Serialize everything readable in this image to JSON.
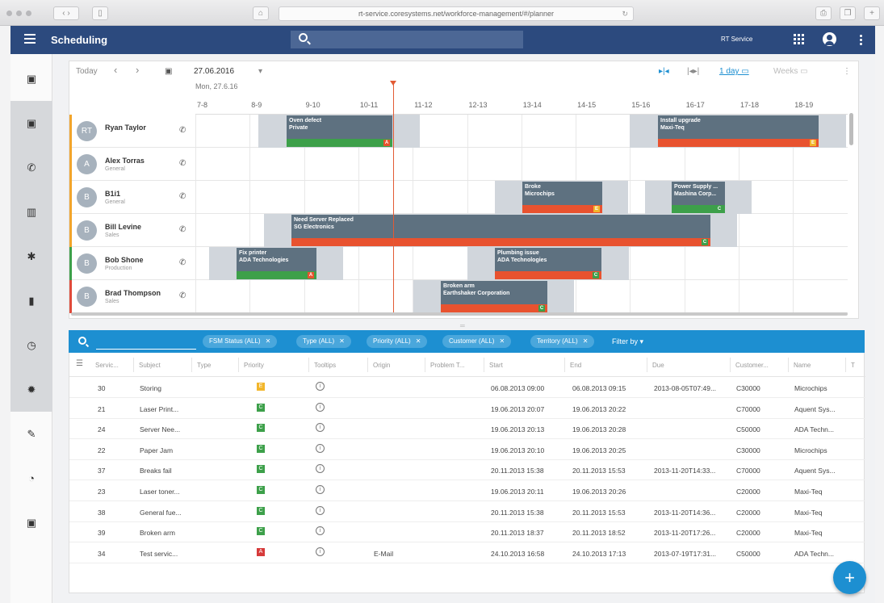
{
  "browser": {
    "url": "rt-service.coresystems.net/workforce-management/#/planner"
  },
  "app": {
    "title": "Scheduling",
    "account": "RT Service"
  },
  "toolbar": {
    "today": "Today",
    "prev": "‹",
    "next": "›",
    "date": "27.06.2016",
    "one_day": "1 day",
    "weeks": "Weeks"
  },
  "planner": {
    "subheader": "Mon, 27.6.16",
    "hours": [
      "7-8",
      "8-9",
      "9-10",
      "10-11",
      "11-12",
      "12-13",
      "13-14",
      "14-15",
      "15-16",
      "16-17",
      "17-18",
      "18-19"
    ],
    "rows": [
      {
        "initials": "RT",
        "name": "Ryan Taylor",
        "sub": "",
        "color": "#f2a52b"
      },
      {
        "initials": "A",
        "name": "Alex Torras",
        "sub": "General",
        "color": "#f2a52b"
      },
      {
        "initials": "B",
        "name": "B1i1",
        "sub": "General",
        "color": "#f2a52b"
      },
      {
        "initials": "B",
        "name": "Bill Levine",
        "sub": "Sales",
        "color": "#f2a52b"
      },
      {
        "initials": "B",
        "name": "Bob Shone",
        "sub": "Production",
        "color": "#3da04a"
      },
      {
        "initials": "B",
        "name": "Brad Thompson",
        "sub": "Sales",
        "color": "#e04a3a"
      }
    ],
    "events": [
      {
        "l1": "Oven defect",
        "l2": "Private",
        "prio": "A"
      },
      {
        "l1": "Install upgrade",
        "l2": "Maxi-Teq",
        "prio": "E"
      },
      {
        "l1": "Broke",
        "l2": "Microchips",
        "prio": "E"
      },
      {
        "l1": "Power Supply ...",
        "l2": "Mashina Corp...",
        "prio": "C"
      },
      {
        "l1": "Need Server Replaced",
        "l2": "SG Electronics",
        "prio": "C"
      },
      {
        "l1": "Fix printer",
        "l2": "ADA Technologies",
        "prio": "A"
      },
      {
        "l1": "Plumbing issue",
        "l2": "ADA Technologies",
        "prio": "C"
      },
      {
        "l1": "Broken arm",
        "l2": "Earthshaker Corporation",
        "prio": "C"
      }
    ]
  },
  "filters": {
    "chips": [
      "FSM Status (ALL)",
      "Type (ALL)",
      "Priority (ALL)",
      "Customer (ALL)",
      "Territory (ALL)"
    ],
    "close": "✕",
    "filter_by": "Filter by"
  },
  "table": {
    "headers": [
      "Servic...",
      "Subject",
      "Type",
      "Priority",
      "Tooltips",
      "Origin",
      "Problem T...",
      "Start",
      "End",
      "Due",
      "Customer...",
      "Name",
      "T"
    ],
    "rows": [
      {
        "id": "30",
        "subject": "Storing",
        "prio": "E",
        "origin": "",
        "start": "06.08.2013 09:00",
        "end": "06.08.2013 09:15",
        "due": "2013-08-05T07:49...",
        "customer": "C30000",
        "name": "Microchips"
      },
      {
        "id": "21",
        "subject": "Laser Print...",
        "prio": "C",
        "origin": "",
        "start": "19.06.2013 20:07",
        "end": "19.06.2013 20:22",
        "due": "",
        "customer": "C70000",
        "name": "Aquent Sys..."
      },
      {
        "id": "24",
        "subject": "Server Nee...",
        "prio": "C",
        "origin": "",
        "start": "19.06.2013 20:13",
        "end": "19.06.2013 20:28",
        "due": "",
        "customer": "C50000",
        "name": "ADA Techn..."
      },
      {
        "id": "22",
        "subject": "Paper Jam",
        "prio": "C",
        "origin": "",
        "start": "19.06.2013 20:10",
        "end": "19.06.2013 20:25",
        "due": "",
        "customer": "C30000",
        "name": "Microchips"
      },
      {
        "id": "37",
        "subject": "Breaks fail",
        "prio": "C",
        "origin": "",
        "start": "20.11.2013 15:38",
        "end": "20.11.2013 15:53",
        "due": "2013-11-20T14:33...",
        "customer": "C70000",
        "name": "Aquent Sys..."
      },
      {
        "id": "23",
        "subject": "Laser toner...",
        "prio": "C",
        "origin": "",
        "start": "19.06.2013 20:11",
        "end": "19.06.2013 20:26",
        "due": "",
        "customer": "C20000",
        "name": "Maxi-Teq"
      },
      {
        "id": "38",
        "subject": "General fue...",
        "prio": "C",
        "origin": "",
        "start": "20.11.2013 15:38",
        "end": "20.11.2013 15:53",
        "due": "2013-11-20T14:36...",
        "customer": "C20000",
        "name": "Maxi-Teq"
      },
      {
        "id": "39",
        "subject": "Broken arm",
        "prio": "C",
        "origin": "",
        "start": "20.11.2013 18:37",
        "end": "20.11.2013 18:52",
        "due": "2013-11-20T17:26...",
        "customer": "C20000",
        "name": "Maxi-Teq"
      },
      {
        "id": "34",
        "subject": "Test servic...",
        "prio": "A",
        "origin": "E-Mail",
        "start": "24.10.2013 16:58",
        "end": "24.10.2013 17:13",
        "due": "2013-07-19T17:31...",
        "customer": "C50000",
        "name": "ADA Techn..."
      }
    ]
  },
  "fab": "+",
  "colors": {
    "header": "#2c4a7e",
    "accent": "#1d8fd1",
    "event": "#5e7180",
    "green": "#3da04a",
    "orange": "#e8522f",
    "yellow": "#f2b62b"
  }
}
